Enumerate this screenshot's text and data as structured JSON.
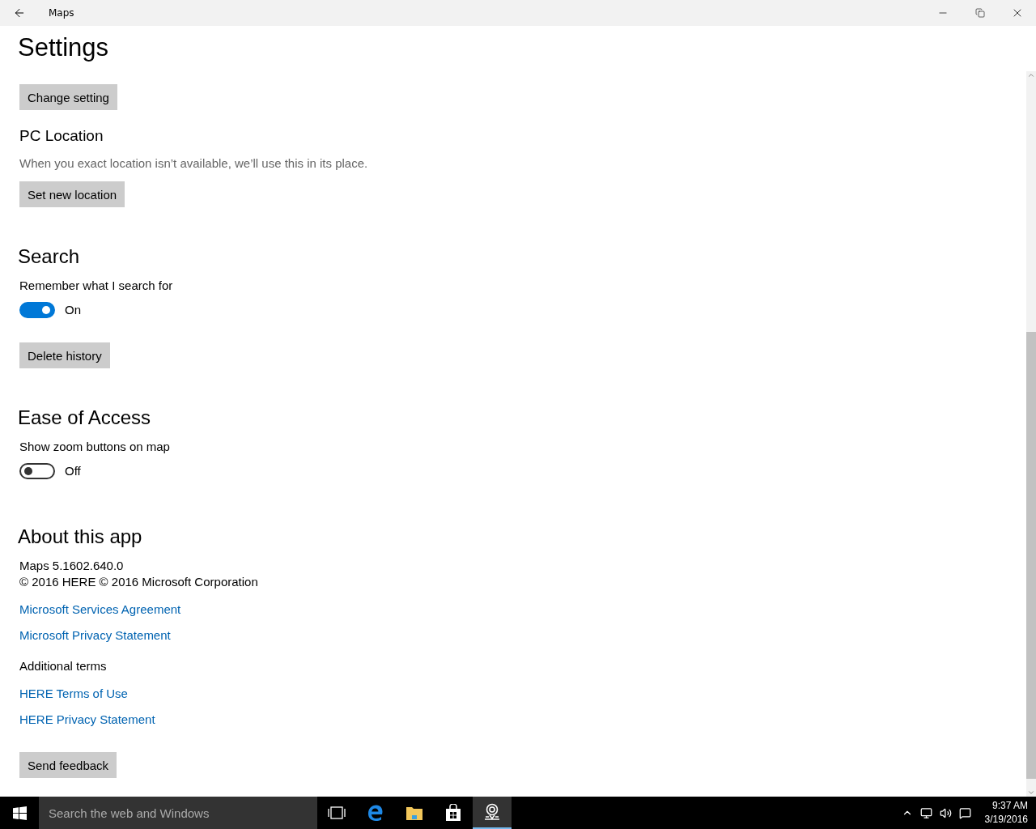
{
  "window": {
    "title": "Maps"
  },
  "page_title": "Settings",
  "content": [
    {
      "kind": "button",
      "label": "Change setting"
    },
    {
      "kind": "subheading",
      "text": "PC Location"
    },
    {
      "kind": "hint",
      "text": "When you exact location isn’t available, we’ll use this in its place."
    },
    {
      "kind": "button",
      "label": "Set new location"
    },
    {
      "kind": "heading",
      "text": "Search"
    },
    {
      "kind": "text",
      "text": "Remember what I search for"
    },
    {
      "kind": "toggle",
      "on": true,
      "state_label": "On"
    },
    {
      "kind": "button",
      "label": "Delete history"
    },
    {
      "kind": "heading",
      "text": "Ease of Access"
    },
    {
      "kind": "text",
      "text": "Show zoom buttons on map"
    },
    {
      "kind": "toggle",
      "on": false,
      "state_label": "Off"
    },
    {
      "kind": "heading",
      "text": "About this app"
    },
    {
      "kind": "text",
      "text": "Maps 5.1602.640.0"
    },
    {
      "kind": "text",
      "text": "© 2016 HERE © 2016 Microsoft Corporation"
    },
    {
      "kind": "link",
      "text": "Microsoft Services Agreement"
    },
    {
      "kind": "link",
      "text": "Microsoft Privacy Statement"
    },
    {
      "kind": "text",
      "text": "Additional terms"
    },
    {
      "kind": "link",
      "text": "HERE Terms of Use"
    },
    {
      "kind": "link",
      "text": "HERE Privacy Statement"
    },
    {
      "kind": "button",
      "label": "Send feedback"
    }
  ],
  "taskbar": {
    "search": {
      "placeholder": "Search the web and Windows"
    },
    "time": "9:37 AM",
    "date": "3/19/2016"
  }
}
